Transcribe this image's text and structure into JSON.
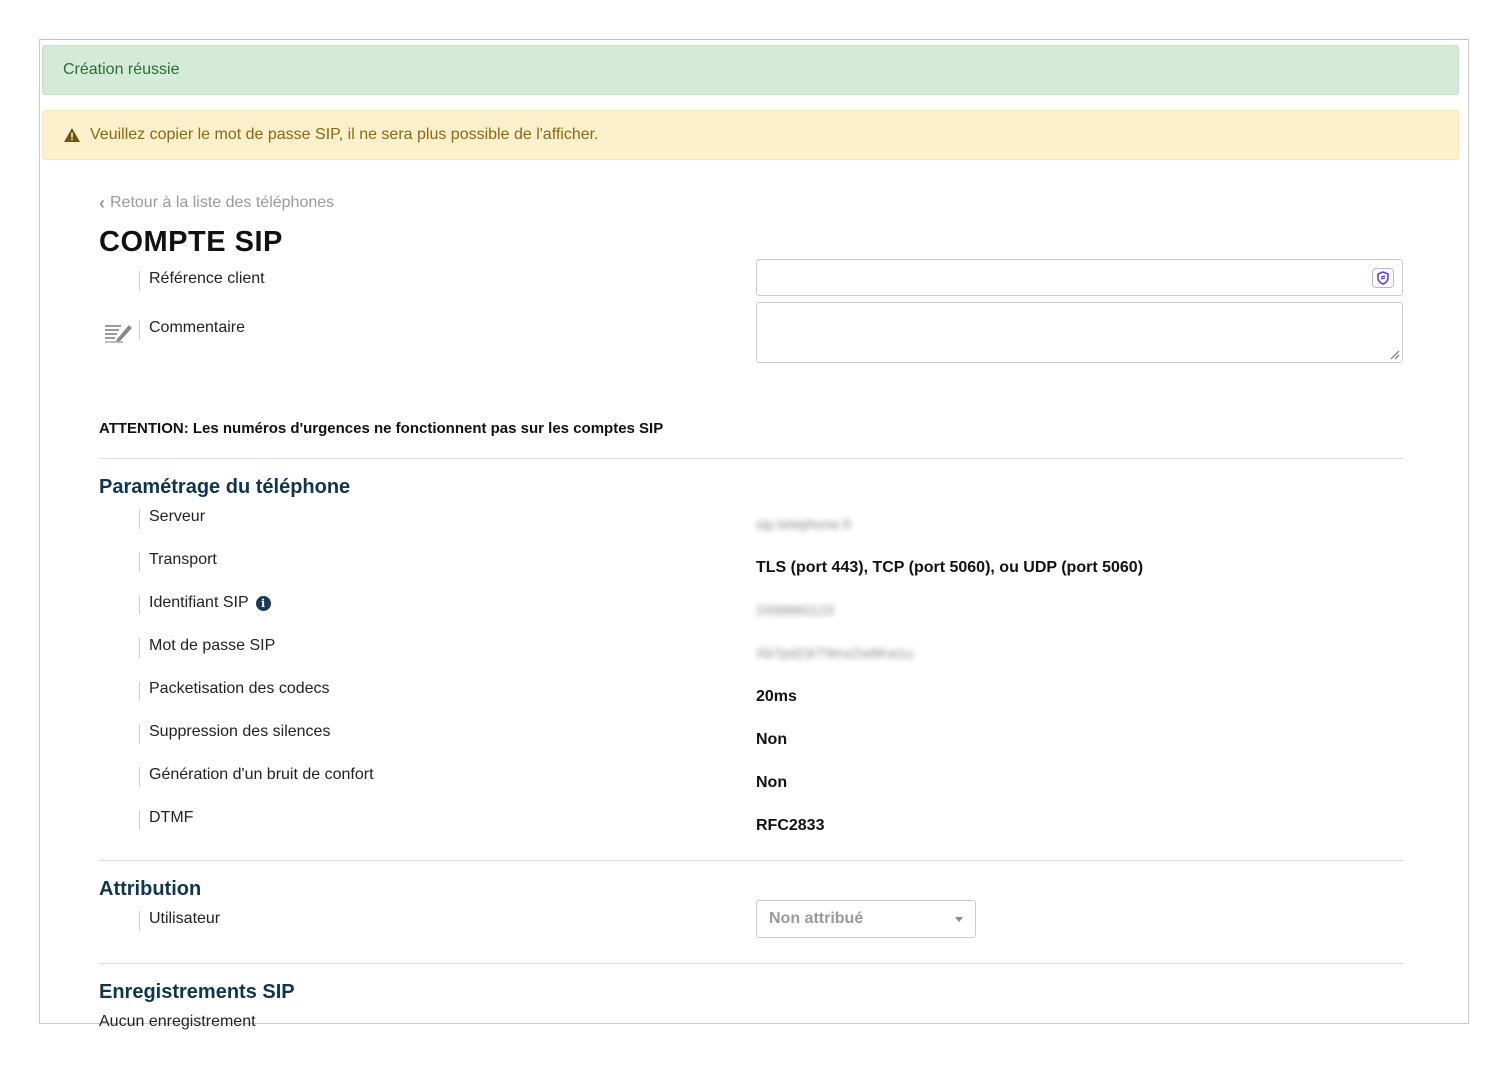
{
  "alerts": {
    "success": "Création réussie",
    "warning": "Veuillez copier le mot de passe SIP, il ne sera plus possible de l'afficher."
  },
  "back_link": "Retour à la liste des téléphones",
  "page_title": "COMPTE SIP",
  "form": {
    "reference_label": "Référence client",
    "reference_value": "",
    "comment_label": "Commentaire",
    "comment_value": ""
  },
  "attention": "ATTENTION: Les numéros d'urgences ne fonctionnent pas sur les comptes SIP",
  "phone_settings": {
    "title": "Paramétrage du téléphone",
    "rows": [
      {
        "label": "Serveur",
        "value": "sip.telephone.fr",
        "blurred": true
      },
      {
        "label": "Transport",
        "value": "TLS (port 443), TCP (port 5060), ou UDP (port 5060)",
        "blurred": false
      },
      {
        "label": "Identifiant SIP",
        "value": "2498860123",
        "blurred": true
      },
      {
        "label": "Mot de passe SIP",
        "value": "Xb7pd23rT9mxZw8Kw1u",
        "blurred": true
      },
      {
        "label": "Packetisation des codecs",
        "value": "20ms",
        "blurred": false
      },
      {
        "label": "Suppression des silences",
        "value": "Non",
        "blurred": false
      },
      {
        "label": "Génération d'un bruit de confort",
        "value": "Non",
        "blurred": false
      },
      {
        "label": "DTMF",
        "value": "RFC2833",
        "blurred": false
      }
    ]
  },
  "attribution": {
    "title": "Attribution",
    "user_label": "Utilisateur",
    "user_selected": "Non attribué"
  },
  "registrations": {
    "title": "Enregistrements SIP",
    "empty_text": "Aucun enregistrement"
  },
  "colors": {
    "success_bg": "#d4ebd8",
    "warning_bg": "#fdf0cd",
    "section_title": "#0f3550"
  }
}
